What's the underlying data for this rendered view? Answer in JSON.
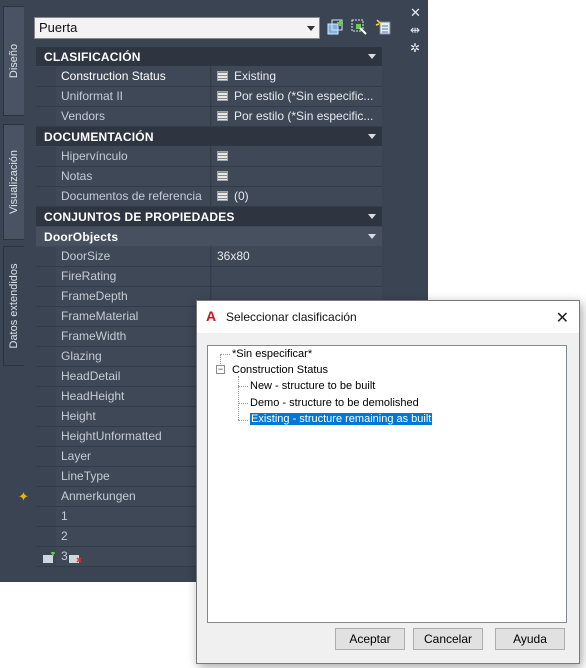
{
  "palette": {
    "tabs": [
      "Diseño",
      "Visualización",
      "Datos extendidos"
    ],
    "object_select": "Puerta",
    "categories": {
      "clasificacion": "CLASIFICACIÓN",
      "documentacion": "DOCUMENTACIÓN",
      "conjuntos": "CONJUNTOS DE PROPIEDADES",
      "doorobjects": "DoorObjects"
    },
    "clasificacion_rows": [
      {
        "name": "Construction Status",
        "value": "Existing"
      },
      {
        "name": "Uniformat II",
        "value": "Por estilo (*Sin especific..."
      },
      {
        "name": "Vendors",
        "value": "Por estilo (*Sin especific..."
      }
    ],
    "documentacion_rows": [
      {
        "name": "Hipervínculo",
        "value": ""
      },
      {
        "name": "Notas",
        "value": ""
      },
      {
        "name": "Documentos de referencia",
        "value": "(0)"
      }
    ],
    "door_rows": [
      {
        "name": "DoorSize",
        "value": "36x80"
      },
      {
        "name": "FireRating",
        "value": ""
      },
      {
        "name": "FrameDepth",
        "value": ""
      },
      {
        "name": "FrameMaterial",
        "value": ""
      },
      {
        "name": "FrameWidth",
        "value": ""
      },
      {
        "name": "Glazing",
        "value": ""
      },
      {
        "name": "HeadDetail",
        "value": ""
      },
      {
        "name": "HeadHeight",
        "value": ""
      },
      {
        "name": "Height",
        "value": ""
      },
      {
        "name": "HeightUnformatted",
        "value": ""
      },
      {
        "name": "Layer",
        "value": ""
      },
      {
        "name": "LineType",
        "value": ""
      },
      {
        "name": "Anmerkungen",
        "value": ""
      },
      {
        "name": "1",
        "value": ""
      },
      {
        "name": "2",
        "value": ""
      },
      {
        "name": "3",
        "value": ""
      }
    ]
  },
  "dialog": {
    "title": "Seleccionar clasificación",
    "tree": {
      "unspecified": "*Sin especificar*",
      "group": "Construction Status",
      "children": [
        "New - structure to be built",
        "Demo - structure to be demolished",
        "Existing - structure remaining as built"
      ],
      "selected_index": 2
    },
    "buttons": {
      "ok": "Aceptar",
      "cancel": "Cancelar",
      "help": "Ayuda"
    }
  },
  "colors": {
    "palette_bg": "#3b4453",
    "selection": "#0078d7",
    "autocad_red": "#c4161c"
  }
}
